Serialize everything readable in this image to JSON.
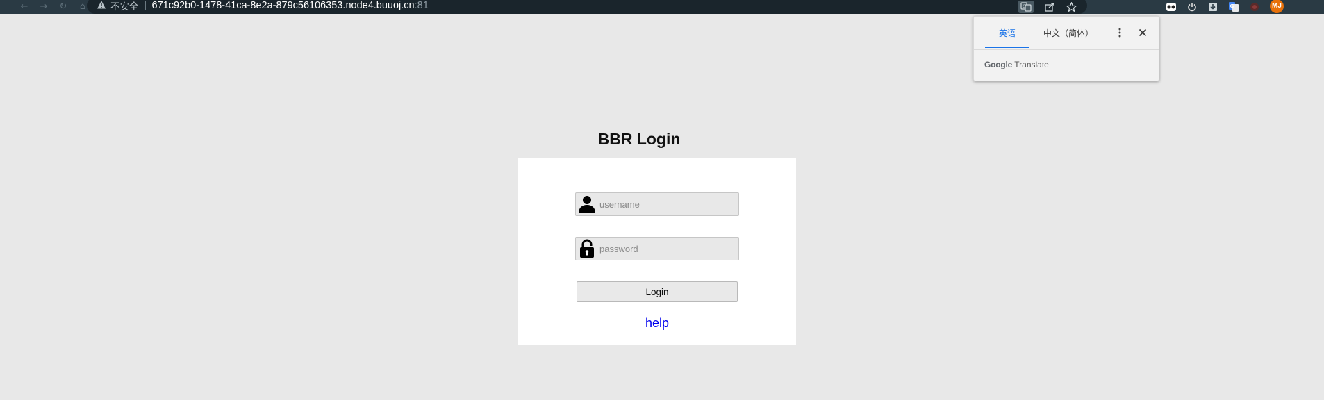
{
  "browser": {
    "insecure_label": "不安全",
    "url_host": "671c92b0-1478-41ca-8e2a-879c56106353.node4.buuoj.cn",
    "url_port": ":81",
    "avatar_initials": "MJ"
  },
  "translate_popup": {
    "tab_english": "英语",
    "tab_chinese": "中文（简体）",
    "brand_google": "Google",
    "brand_translate": "Translate"
  },
  "login": {
    "title": "BBR Login",
    "username_placeholder": "username",
    "password_placeholder": "password",
    "login_button": "Login",
    "help_link": "help"
  },
  "colors": {
    "page_background": "#e8e8e8",
    "topbar": "#2a3a44",
    "link": "#0000ee",
    "avatar": "#e8710a",
    "translate_accent": "#1a73e8"
  },
  "icons": {
    "browser": [
      "back-icon",
      "forward-icon",
      "reload-icon",
      "home-icon",
      "warning-icon",
      "translate-icon",
      "share-icon",
      "bookmark-star-icon"
    ],
    "extensions": [
      "extension-glasses-icon",
      "power-icon",
      "download-icon",
      "google-translate-icon",
      "extension-red-icon"
    ],
    "login": [
      "user-icon",
      "lock-icon"
    ]
  }
}
